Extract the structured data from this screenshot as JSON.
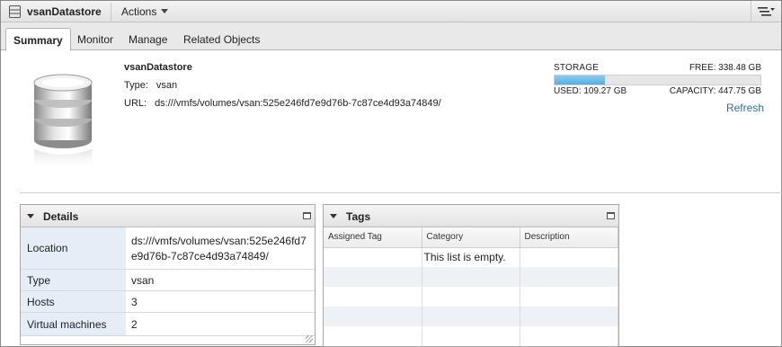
{
  "window": {
    "title": "vsanDatastore",
    "actions_label": "Actions"
  },
  "tabs": [
    {
      "label": "Summary",
      "active": true
    },
    {
      "label": "Monitor",
      "active": false
    },
    {
      "label": "Manage",
      "active": false
    },
    {
      "label": "Related Objects",
      "active": false
    }
  ],
  "summary": {
    "name": "vsanDatastore",
    "type_label": "Type:",
    "type_value": "vsan",
    "url_label": "URL:",
    "url_value": "ds:///vmfs/volumes/vsan:525e246fd7e9d76b-7c87ce4d93a74849/"
  },
  "storage": {
    "label": "STORAGE",
    "free": "FREE: 338.48 GB",
    "used": "USED: 109.27 GB",
    "capacity": "CAPACITY: 447.75 GB",
    "used_fraction": 0.244,
    "refresh_label": "Refresh",
    "bar_color": "#6cb8e6"
  },
  "details": {
    "title": "Details",
    "rows": [
      {
        "key": "Location",
        "value": "ds:///vmfs/volumes/vsan:525e246fd7e9d76b-7c87ce4d93a74849/"
      },
      {
        "key": "Type",
        "value": "vsan"
      },
      {
        "key": "Hosts",
        "value": "3"
      },
      {
        "key": "Virtual machines",
        "value": "2"
      }
    ]
  },
  "tags": {
    "title": "Tags",
    "columns": [
      "Assigned Tag",
      "Category",
      "Description"
    ],
    "empty_message": "This list is empty."
  },
  "icons": {
    "window_icon": "datastore-icon",
    "menu_icon": "list-menu-icon",
    "large_icon": "database-icon"
  }
}
